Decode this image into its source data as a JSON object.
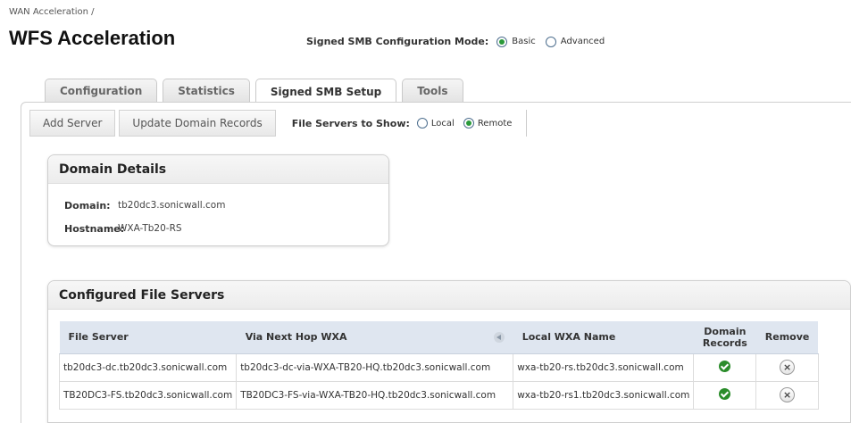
{
  "breadcrumb": "WAN Acceleration /",
  "page_title": "WFS Acceleration",
  "mode": {
    "label": "Signed SMB Configuration Mode:",
    "options": [
      {
        "label": "Basic",
        "checked": true
      },
      {
        "label": "Advanced",
        "checked": false
      }
    ]
  },
  "tabs": [
    {
      "label": "Configuration",
      "active": false
    },
    {
      "label": "Statistics",
      "active": false
    },
    {
      "label": "Signed SMB Setup",
      "active": true
    },
    {
      "label": "Tools",
      "active": false
    }
  ],
  "toolbar": {
    "add_server": "Add Server",
    "update_domain": "Update Domain Records",
    "show_label": "File Servers to Show:",
    "show_options": [
      {
        "label": "Local",
        "checked": false
      },
      {
        "label": "Remote",
        "checked": true
      }
    ]
  },
  "domain_details": {
    "title": "Domain Details",
    "domain_label": "Domain:",
    "domain_value": "tb20dc3.sonicwall.com",
    "hostname_label": "Hostname:",
    "hostname_value": "WXA-Tb20-RS"
  },
  "file_servers": {
    "title": "Configured File Servers",
    "columns": [
      "File Server",
      "Via Next Hop WXA",
      "Local WXA Name",
      "Domain Records",
      "Remove"
    ],
    "rows": [
      {
        "file_server": "tb20dc3-dc.tb20dc3.sonicwall.com",
        "via": "tb20dc3-dc-via-WXA-TB20-HQ.tb20dc3.sonicwall.com",
        "local": "wxa-tb20-rs.tb20dc3.sonicwall.com"
      },
      {
        "file_server": "TB20DC3-FS.tb20dc3.sonicwall.com",
        "via": "TB20DC3-FS-via-WXA-TB20-HQ.tb20dc3.sonicwall.com",
        "local": "wxa-tb20-rs1.tb20dc3.sonicwall.com"
      }
    ]
  },
  "icons": {
    "domain_record": "check-icon",
    "remove": "close-icon",
    "sort": "sort-left-icon"
  }
}
